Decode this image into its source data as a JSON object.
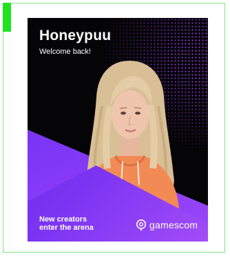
{
  "card": {
    "title": "Honeypuu",
    "subtitle": "Welcome back!",
    "tagline_line1": "New creators",
    "tagline_line2": "enter the arena",
    "brand": "gamescom"
  },
  "colors": {
    "background": "#050507",
    "accent_purple": "#7b34f2",
    "dots": "#aa3cff",
    "hoodie": "#f28a56",
    "frame_border": "#7ee37e",
    "corner_tab": "#1fe31f"
  },
  "icons": {
    "brand_logo": "gamescom-logo-icon"
  }
}
